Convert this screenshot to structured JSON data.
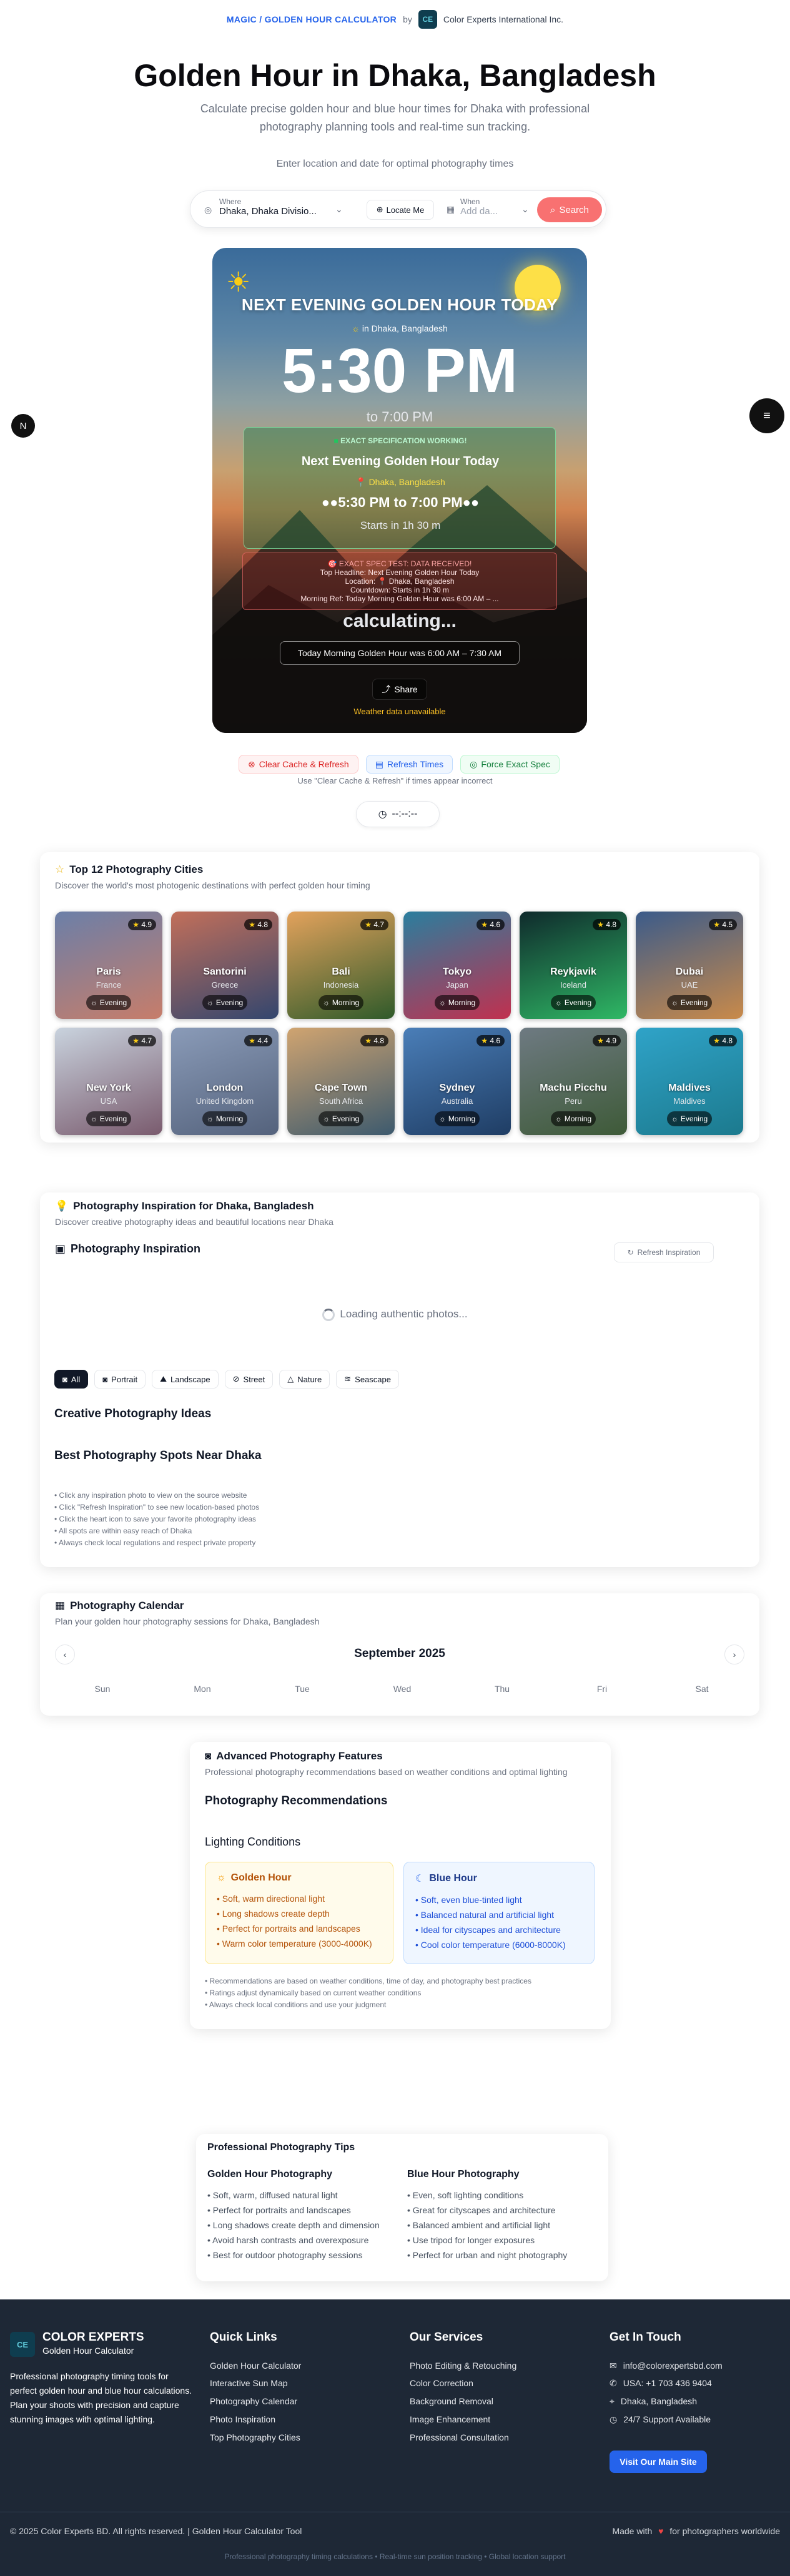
{
  "topbar": {
    "crumb": "MAGIC / GOLDEN HOUR CALCULATOR",
    "by": "by",
    "company": "Color Experts International Inc.",
    "logo_text": "CE"
  },
  "header": {
    "title": "Golden Hour in Dhaka, Bangladesh",
    "subtitle": "Calculate precise golden hour and blue hour times for Dhaka with professional photography planning tools and real-time sun tracking.",
    "hint": "Enter location and date for optimal photography times"
  },
  "search": {
    "where_label": "Where",
    "where_value": "Dhaka, Dhaka Divisio...",
    "locate_label": "Locate Me",
    "when_label": "When",
    "when_placeholder": "Add da...",
    "search_label": "Search"
  },
  "hero": {
    "heading": "NEXT EVENING GOLDEN HOUR TODAY",
    "location": "in Dhaka, Bangladesh",
    "time": "5:30 PM",
    "to_time": "to 7:00 PM",
    "spec_title": "EXACT SPECIFICATION WORKING!",
    "spec_main": "Next Evening Golden Hour Today",
    "spec_loc": "Dhaka, Bangladesh",
    "spec_time": "●●5:30 PM to 7:00 PM●●",
    "spec_starts": "Starts in 1h 30 m",
    "debug_lines": [
      "🎯 EXACT SPEC TEST: DATA RECEIVED!",
      "Top Headline: Next Evening Golden Hour Today",
      "Location: 📍 Dhaka, Bangladesh",
      "Countdown: Starts in 1h 30 m",
      "Morning Ref: Today Morning Golden Hour was 6:00 AM – ..."
    ],
    "calculating": "calculating...",
    "morning": "Today Morning Golden Hour was 6:00 AM – 7:30 AM",
    "share_label": "Share",
    "weather": "Weather data unavailable"
  },
  "side_left_icon": "N",
  "tools": {
    "clear": "Clear Cache & Refresh",
    "refresh": "Refresh Times",
    "force": "Force Exact Spec",
    "hint": "Use \"Clear Cache & Refresh\" if times appear incorrect",
    "clock": "--:--:--"
  },
  "cities": {
    "title": "Top 12 Photography Cities",
    "subtitle": "Discover the world's most photogenic destinations with perfect golden hour timing",
    "items": [
      {
        "name": "Paris",
        "country": "France",
        "rating": "4.9",
        "time": "Evening",
        "c1": "#6b7fa8",
        "c2": "#c77d6a"
      },
      {
        "name": "Santorini",
        "country": "Greece",
        "rating": "4.8",
        "time": "Evening",
        "c1": "#c26f5a",
        "c2": "#33466e"
      },
      {
        "name": "Bali",
        "country": "Indonesia",
        "rating": "4.7",
        "time": "Morning",
        "c1": "#e3a25c",
        "c2": "#2f5a2a"
      },
      {
        "name": "Tokyo",
        "country": "Japan",
        "rating": "4.6",
        "time": "Morning",
        "c1": "#2a7e9e",
        "c2": "#c1304f"
      },
      {
        "name": "Reykjavik",
        "country": "Iceland",
        "rating": "4.8",
        "time": "Evening",
        "c1": "#0f2a2c",
        "c2": "#2fb865"
      },
      {
        "name": "Dubai",
        "country": "UAE",
        "rating": "4.5",
        "time": "Evening",
        "c1": "#3b5b8a",
        "c2": "#c98a4a"
      },
      {
        "name": "New York",
        "country": "USA",
        "rating": "4.7",
        "time": "Evening",
        "c1": "#c9d3de",
        "c2": "#7a5b6e"
      },
      {
        "name": "London",
        "country": "United Kingdom",
        "rating": "4.4",
        "time": "Morning",
        "c1": "#8a9bb8",
        "c2": "#54627c"
      },
      {
        "name": "Cape Town",
        "country": "South Africa",
        "rating": "4.8",
        "time": "Evening",
        "c1": "#d0a470",
        "c2": "#3d5a6e"
      },
      {
        "name": "Sydney",
        "country": "Australia",
        "rating": "4.6",
        "time": "Morning",
        "c1": "#4a7eb8",
        "c2": "#1f3d64"
      },
      {
        "name": "Machu Picchu",
        "country": "Peru",
        "rating": "4.9",
        "time": "Morning",
        "c1": "#6e7a82",
        "c2": "#3e5a38"
      },
      {
        "name": "Maldives",
        "country": "Maldives",
        "rating": "4.8",
        "time": "Evening",
        "c1": "#2fa3c8",
        "c2": "#1c7a8e"
      }
    ]
  },
  "inspiration": {
    "title": "Photography Inspiration for Dhaka, Bangladesh",
    "subtitle": "Discover creative photography ideas and beautiful locations near Dhaka",
    "heading": "Photography Inspiration",
    "refresh": "Refresh Inspiration",
    "loading": "Loading authentic photos...",
    "filters": [
      "All",
      "Portrait",
      "Landscape",
      "Street",
      "Nature",
      "Seascape"
    ],
    "creative": "Creative Photography Ideas",
    "spots": "Best Photography Spots Near Dhaka",
    "notes": [
      "• Click any inspiration photo to view on the source website",
      "• Click \"Refresh Inspiration\" to see new location-based photos",
      "• Click the heart icon to save your favorite photography ideas",
      "• All spots are within easy reach of Dhaka",
      "• Always check local regulations and respect private property"
    ]
  },
  "calendar": {
    "title": "Photography Calendar",
    "subtitle": "Plan your golden hour photography sessions for Dhaka, Bangladesh",
    "month": "September 2025",
    "weekdays": [
      "Sun",
      "Mon",
      "Tue",
      "Wed",
      "Thu",
      "Fri",
      "Sat"
    ]
  },
  "advanced": {
    "title": "Advanced Photography Features",
    "subtitle": "Professional photography recommendations based on weather conditions and optimal lighting",
    "recs": "Photography Recommendations",
    "lighting": "Lighting Conditions",
    "golden_title": "Golden Hour",
    "golden_items": [
      "• Soft, warm directional light",
      "• Long shadows create depth",
      "• Perfect for portraits and landscapes",
      "• Warm color temperature (3000-4000K)"
    ],
    "blue_title": "Blue Hour",
    "blue_items": [
      "• Soft, even blue-tinted light",
      "• Balanced natural and artificial light",
      "• Ideal for cityscapes and architecture",
      "• Cool color temperature (6000-8000K)"
    ],
    "notes": [
      "• Recommendations are based on weather conditions, time of day, and photography best practices",
      "• Ratings adjust dynamically based on current weather conditions",
      "• Always check local conditions and use your judgment"
    ]
  },
  "tips": {
    "title": "Professional Photography Tips",
    "golden_title": "Golden Hour Photography",
    "golden_items": [
      "• Soft, warm, diffused natural light",
      "• Perfect for portraits and landscapes",
      "• Long shadows create depth and dimension",
      "• Avoid harsh contrasts and overexposure",
      "• Best for outdoor photography sessions"
    ],
    "blue_title": "Blue Hour Photography",
    "blue_items": [
      "• Even, soft lighting conditions",
      "• Great for cityscapes and architecture",
      "• Balanced ambient and artificial light",
      "• Use tripod for longer exposures",
      "• Perfect for urban and night photography"
    ]
  },
  "footer": {
    "brand": "COLOR EXPERTS",
    "brand_sub": "Golden Hour Calculator",
    "desc": "Professional photography timing tools for perfect golden hour and blue hour calculations. Plan your shoots with precision and capture stunning images with optimal lighting.",
    "quick_title": "Quick Links",
    "quick": [
      "Golden Hour Calculator",
      "Interactive Sun Map",
      "Photography Calendar",
      "Photo Inspiration",
      "Top Photography Cities"
    ],
    "services_title": "Our Services",
    "services": [
      "Photo Editing & Retouching",
      "Color Correction",
      "Background Removal",
      "Image Enhancement",
      "Professional Consultation"
    ],
    "contact_title": "Get In Touch",
    "email": "info@colorexpertsbd.com",
    "phone": "USA: +1 703 436 9404",
    "location": "Dhaka, Bangladesh",
    "support": "24/7 Support Available",
    "visit": "Visit Our Main Site",
    "copyright": "© 2025 Color Experts BD. All rights reserved. | Golden Hour Calculator Tool",
    "made_with": "Made with",
    "made_for": "for photographers worldwide",
    "tagline": "Professional photography timing calculations • Real-time sun position tracking • Global location support"
  }
}
